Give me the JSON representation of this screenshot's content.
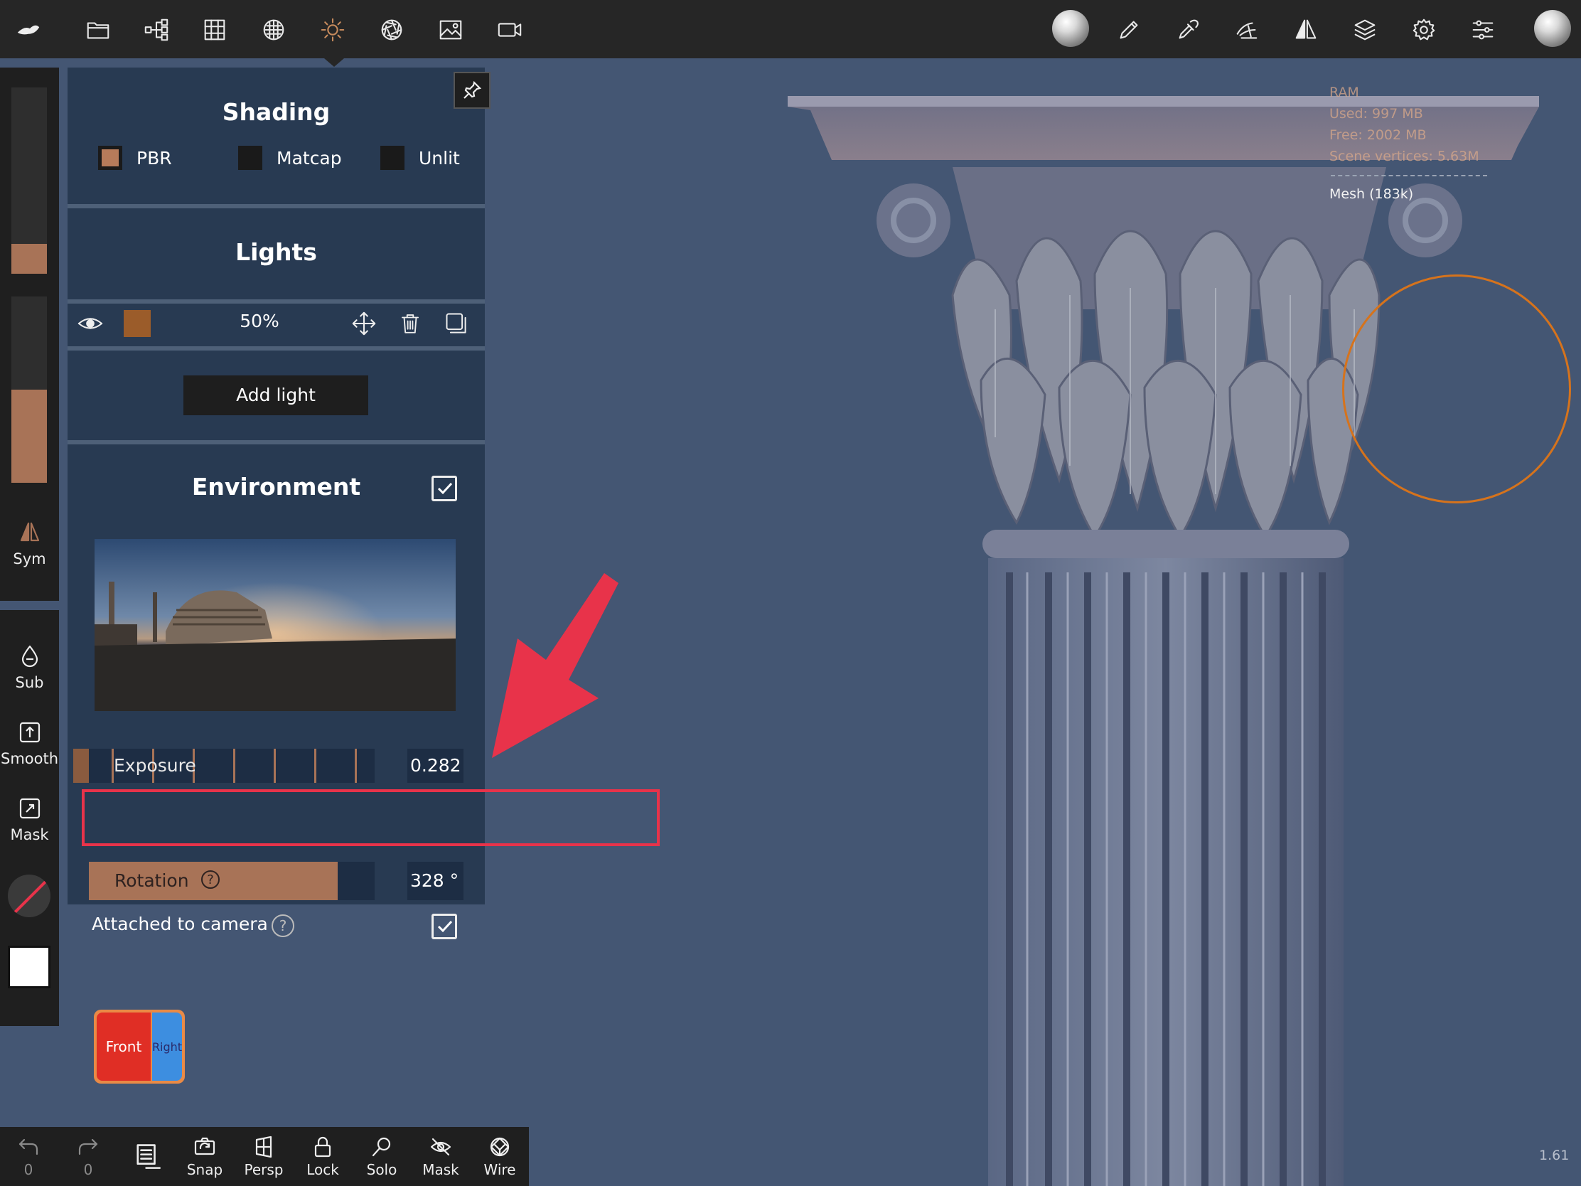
{
  "shading": {
    "title": "Shading",
    "options": [
      {
        "label": "PBR",
        "selected": true
      },
      {
        "label": "Matcap",
        "selected": false
      },
      {
        "label": "Unlit",
        "selected": false
      }
    ]
  },
  "lights": {
    "title": "Lights",
    "light": {
      "intensity": "50%",
      "color": "#9b5c2a"
    },
    "add_label": "Add light"
  },
  "environment": {
    "title": "Environment",
    "enabled": true,
    "exposure": {
      "label": "Exposure",
      "value": "0.282"
    },
    "rotation": {
      "label": "Rotation",
      "value": "328 °",
      "fraction": 0.87
    },
    "attached_label": "Attached to camera",
    "attached": true
  },
  "left_tools": {
    "sym": "Sym",
    "sub": "Sub",
    "smooth": "Smooth",
    "mask": "Mask",
    "slider_radius_fraction": 0.16,
    "slider_intensity_fraction": 0.5
  },
  "stats": {
    "ram": "RAM",
    "used": "Used: 997 MB",
    "free": "Free: 2002 MB",
    "vertices": "Scene vertices: 5.63M",
    "mesh": "Mesh (183k)"
  },
  "cube": {
    "front": "Front",
    "right": "Right"
  },
  "bottom": {
    "undo_count": "0",
    "redo_count": "0",
    "snap": "Snap",
    "persp": "Persp",
    "lock": "Lock",
    "solo": "Solo",
    "mask": "Mask",
    "wire": "Wire"
  },
  "version": "1.61",
  "colors": {
    "accent": "#c78b5d",
    "annotation": "#e8334a",
    "brush": "#d6731c"
  }
}
